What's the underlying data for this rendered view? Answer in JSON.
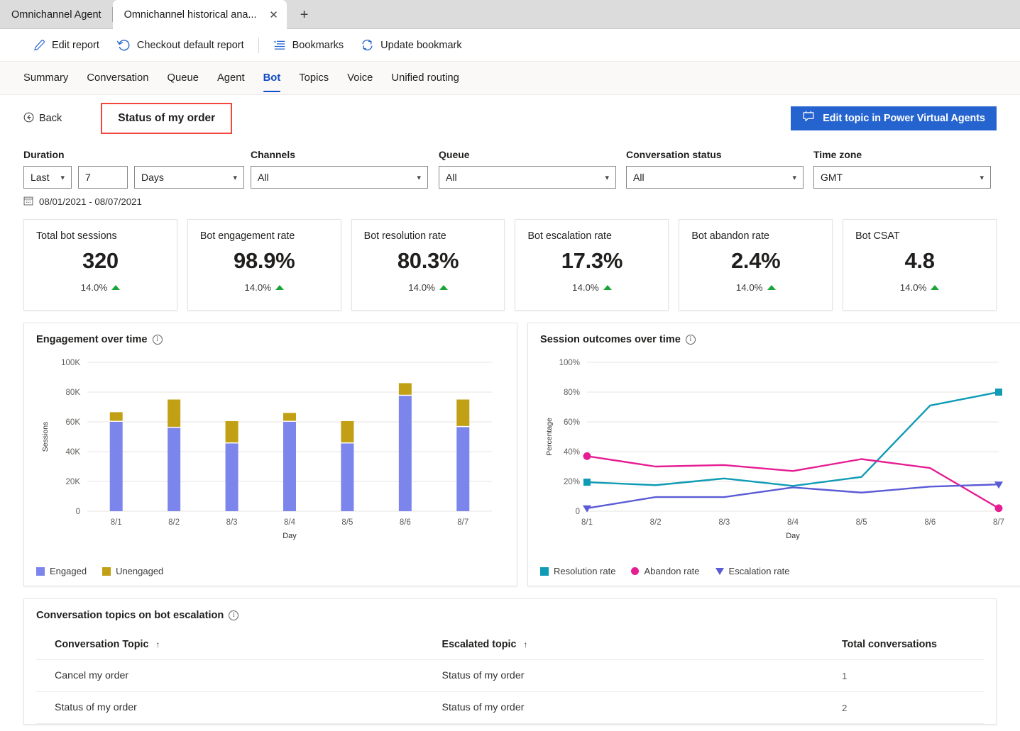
{
  "browser": {
    "tabs": [
      {
        "title": "Omnichannel Agent",
        "active": false
      },
      {
        "title": "Omnichannel historical ana...",
        "active": true
      }
    ],
    "close_label": "✕",
    "new_tab_label": "+"
  },
  "commandbar": {
    "items": [
      {
        "label": "Edit report",
        "icon": "pencil-icon"
      },
      {
        "label": "Checkout default report",
        "icon": "undo-icon"
      },
      {
        "label": "Bookmarks",
        "icon": "bookmarks-list-icon"
      },
      {
        "label": "Update bookmark",
        "icon": "refresh-icon"
      }
    ]
  },
  "navtabs": {
    "items": [
      "Summary",
      "Conversation",
      "Queue",
      "Agent",
      "Bot",
      "Topics",
      "Voice",
      "Unified routing"
    ],
    "selected": "Bot"
  },
  "toolbar": {
    "back_label": "Back",
    "report_title": "Status of my order",
    "pva_button_label": "Edit topic in Power Virtual Agents",
    "highlight_color": "#f0463c",
    "accent_color": "#2564cf"
  },
  "filters": {
    "duration": {
      "label": "Duration",
      "relative": "Last",
      "amount": "7",
      "unit": "Days",
      "date_range": "08/01/2021 - 08/07/2021"
    },
    "channels": {
      "label": "Channels",
      "value": "All"
    },
    "queue": {
      "label": "Queue",
      "value": "All"
    },
    "conversation_status": {
      "label": "Conversation status",
      "value": "All"
    },
    "time_zone": {
      "label": "Time zone",
      "value": "GMT"
    }
  },
  "kpis": [
    {
      "title": "Total bot sessions",
      "value": "320",
      "delta": "14.0%",
      "trend": "up"
    },
    {
      "title": "Bot engagement rate",
      "value": "98.9%",
      "delta": "14.0%",
      "trend": "up"
    },
    {
      "title": "Bot resolution rate",
      "value": "80.3%",
      "delta": "14.0%",
      "trend": "up"
    },
    {
      "title": "Bot escalation rate",
      "value": "17.3%",
      "delta": "14.0%",
      "trend": "up"
    },
    {
      "title": "Bot abandon rate",
      "value": "2.4%",
      "delta": "14.0%",
      "trend": "up"
    },
    {
      "title": "Bot CSAT",
      "value": "4.8",
      "delta": "14.0%",
      "trend": "up"
    }
  ],
  "chart_data": [
    {
      "type": "bar",
      "stacked": true,
      "title": "Engagement over time",
      "xlabel": "Day",
      "ylabel": "Sessions",
      "categories": [
        "8/1",
        "8/2",
        "8/3",
        "8/4",
        "8/5",
        "8/6",
        "8/7"
      ],
      "ytick_labels": [
        "0",
        "20K",
        "40K",
        "60K",
        "80K",
        "100K"
      ],
      "ytick_values": [
        0,
        20000,
        40000,
        60000,
        80000,
        100000
      ],
      "ylim": [
        0,
        100000
      ],
      "grid": true,
      "legend_position": "bottom-left",
      "series": [
        {
          "name": "Engaged",
          "color": "#7b85eb",
          "values": [
            60000,
            56000,
            45500,
            60000,
            45500,
            77500,
            56500
          ]
        },
        {
          "name": "Unengaged",
          "color": "#c2a015",
          "values": [
            6500,
            19000,
            15000,
            6000,
            15000,
            8500,
            18500
          ]
        }
      ]
    },
    {
      "type": "line",
      "title": "Session outcomes over time",
      "xlabel": "Day",
      "ylabel": "Percentage",
      "x": [
        "8/1",
        "8/2",
        "8/3",
        "8/4",
        "8/5",
        "8/6",
        "8/7"
      ],
      "ytick_labels": [
        "0",
        "20%",
        "40%",
        "60%",
        "80%",
        "100%"
      ],
      "ytick_values": [
        0,
        20,
        40,
        60,
        80,
        100
      ],
      "ylim": [
        0,
        100
      ],
      "grid": true,
      "legend_position": "bottom-left",
      "series": [
        {
          "name": "Resolution rate",
          "color": "#0f9bb5",
          "marker": "square",
          "values": [
            19.5,
            17.5,
            22,
            17,
            23,
            71,
            80
          ]
        },
        {
          "name": "Abandon rate",
          "color": "#e61c93",
          "marker": "circle",
          "values": [
            37,
            30,
            31,
            27,
            35,
            29,
            2
          ]
        },
        {
          "name": "Escalation rate",
          "color": "#5b5bd6",
          "marker": "triangle-down",
          "values": [
            2,
            9.5,
            9.5,
            16,
            12.5,
            16.5,
            18
          ]
        }
      ]
    }
  ],
  "topics_table": {
    "title": "Conversation topics on bot escalation",
    "columns": [
      "Conversation Topic",
      "Escalated topic",
      "Total conversations"
    ],
    "sort_indicator": "↑",
    "rows": [
      {
        "topic": "Cancel my order",
        "escalated": "Status of my order",
        "total": "1"
      },
      {
        "topic": "Status of my order",
        "escalated": "Status of my order",
        "total": "2"
      }
    ]
  }
}
